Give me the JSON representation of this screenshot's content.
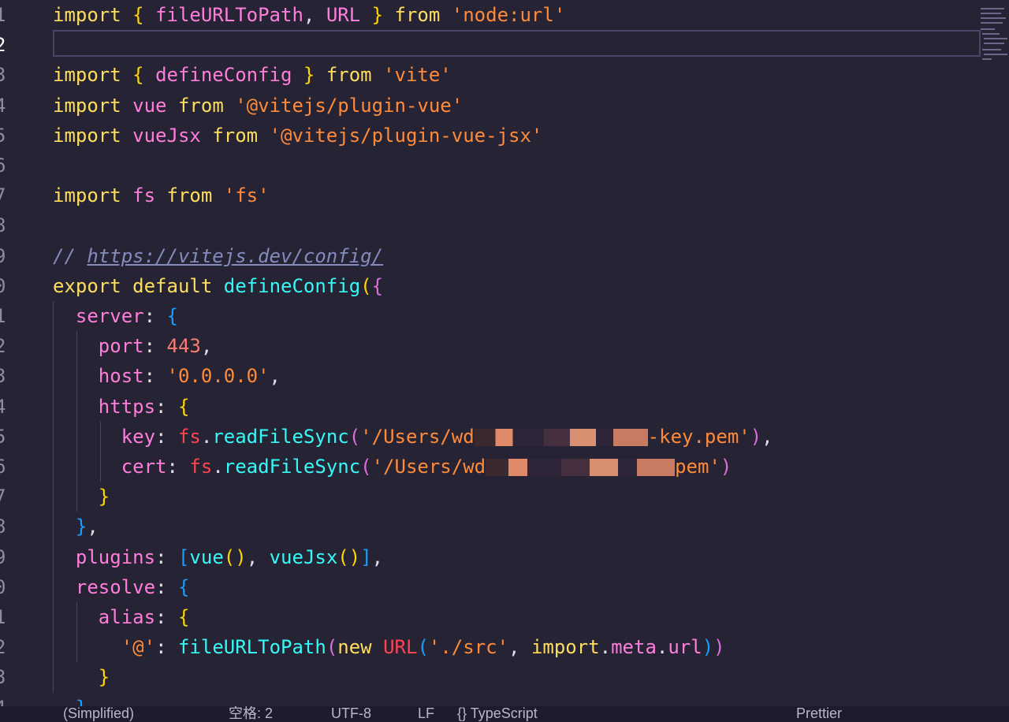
{
  "editor": {
    "active_line": 2,
    "lines": [
      {
        "n": "1",
        "tokens": [
          [
            "kw",
            "import"
          ],
          [
            "plain",
            " "
          ],
          [
            "br1",
            "{"
          ],
          [
            "plain",
            " "
          ],
          [
            "prop",
            "fileURLToPath"
          ],
          [
            "plain",
            ", "
          ],
          [
            "prop",
            "URL"
          ],
          [
            "plain",
            " "
          ],
          [
            "br1",
            "}"
          ],
          [
            "plain",
            " "
          ],
          [
            "kw",
            "from"
          ],
          [
            "plain",
            " "
          ],
          [
            "str",
            "'node:url'"
          ]
        ]
      },
      {
        "n": "2",
        "tokens": []
      },
      {
        "n": "3",
        "tokens": [
          [
            "kw",
            "import"
          ],
          [
            "plain",
            " "
          ],
          [
            "br1",
            "{"
          ],
          [
            "plain",
            " "
          ],
          [
            "prop",
            "defineConfig"
          ],
          [
            "plain",
            " "
          ],
          [
            "br1",
            "}"
          ],
          [
            "plain",
            " "
          ],
          [
            "kw",
            "from"
          ],
          [
            "plain",
            " "
          ],
          [
            "str",
            "'vite'"
          ]
        ]
      },
      {
        "n": "4",
        "tokens": [
          [
            "kw",
            "import"
          ],
          [
            "plain",
            " "
          ],
          [
            "prop",
            "vue"
          ],
          [
            "plain",
            " "
          ],
          [
            "kw",
            "from"
          ],
          [
            "plain",
            " "
          ],
          [
            "str",
            "'@vitejs/plugin-vue'"
          ]
        ]
      },
      {
        "n": "5",
        "tokens": [
          [
            "kw",
            "import"
          ],
          [
            "plain",
            " "
          ],
          [
            "prop",
            "vueJsx"
          ],
          [
            "plain",
            " "
          ],
          [
            "kw",
            "from"
          ],
          [
            "plain",
            " "
          ],
          [
            "str",
            "'@vitejs/plugin-vue-jsx'"
          ]
        ]
      },
      {
        "n": "6",
        "tokens": []
      },
      {
        "n": "7",
        "tokens": [
          [
            "kw",
            "import"
          ],
          [
            "plain",
            " "
          ],
          [
            "prop",
            "fs"
          ],
          [
            "plain",
            " "
          ],
          [
            "kw",
            "from"
          ],
          [
            "plain",
            " "
          ],
          [
            "str",
            "'fs'"
          ]
        ]
      },
      {
        "n": "8",
        "tokens": []
      },
      {
        "n": "9",
        "tokens": [
          [
            "cmt",
            "// "
          ],
          [
            "url",
            "https://vitejs.dev/config/"
          ]
        ]
      },
      {
        "n": "0",
        "tokens": [
          [
            "kw",
            "export"
          ],
          [
            "plain",
            " "
          ],
          [
            "kw",
            "default"
          ],
          [
            "plain",
            " "
          ],
          [
            "fn",
            "defineConfig"
          ],
          [
            "br1",
            "("
          ],
          [
            "br2",
            "{"
          ]
        ]
      },
      {
        "n": "1",
        "tokens": [
          [
            "plain",
            "  "
          ],
          [
            "prop",
            "server"
          ],
          [
            "plain",
            ": "
          ],
          [
            "br3",
            "{"
          ]
        ]
      },
      {
        "n": "2",
        "tokens": [
          [
            "plain",
            "    "
          ],
          [
            "prop",
            "port"
          ],
          [
            "plain",
            ": "
          ],
          [
            "num",
            "443"
          ],
          [
            "plain",
            ","
          ]
        ]
      },
      {
        "n": "3",
        "tokens": [
          [
            "plain",
            "    "
          ],
          [
            "prop",
            "host"
          ],
          [
            "plain",
            ": "
          ],
          [
            "str",
            "'0.0.0.0'"
          ],
          [
            "plain",
            ","
          ]
        ]
      },
      {
        "n": "4",
        "tokens": [
          [
            "plain",
            "    "
          ],
          [
            "prop",
            "https"
          ],
          [
            "plain",
            ": "
          ],
          [
            "br1",
            "{"
          ]
        ]
      },
      {
        "n": "5",
        "tokens": [
          [
            "plain",
            "      "
          ],
          [
            "prop",
            "key"
          ],
          [
            "plain",
            ": "
          ],
          [
            "mod",
            "fs"
          ],
          [
            "plain",
            "."
          ],
          [
            "fn",
            "readFileSync"
          ],
          [
            "br2",
            "("
          ],
          [
            "str",
            "'/Users/wd"
          ],
          [
            "blur",
            "220"
          ],
          [
            "str",
            "-key.pem'"
          ],
          [
            "br2",
            ")"
          ],
          [
            "plain",
            ","
          ]
        ]
      },
      {
        "n": "6",
        "tokens": [
          [
            "plain",
            "      "
          ],
          [
            "prop",
            "cert"
          ],
          [
            "plain",
            ": "
          ],
          [
            "mod",
            "fs"
          ],
          [
            "plain",
            "."
          ],
          [
            "fn",
            "readFileSync"
          ],
          [
            "br2",
            "("
          ],
          [
            "str",
            "'/Users/wd"
          ],
          [
            "blur",
            "240"
          ],
          [
            "str",
            "pem'"
          ],
          [
            "br2",
            ")"
          ]
        ]
      },
      {
        "n": "7",
        "tokens": [
          [
            "plain",
            "    "
          ],
          [
            "br1",
            "}"
          ]
        ]
      },
      {
        "n": "8",
        "tokens": [
          [
            "plain",
            "  "
          ],
          [
            "br3",
            "}"
          ],
          [
            "plain",
            ","
          ]
        ]
      },
      {
        "n": "9",
        "tokens": [
          [
            "plain",
            "  "
          ],
          [
            "prop",
            "plugins"
          ],
          [
            "plain",
            ": "
          ],
          [
            "br3",
            "["
          ],
          [
            "fn",
            "vue"
          ],
          [
            "br1",
            "()"
          ],
          [
            "plain",
            ", "
          ],
          [
            "fn",
            "vueJsx"
          ],
          [
            "br1",
            "()"
          ],
          [
            "br3",
            "]"
          ],
          [
            "plain",
            ","
          ]
        ]
      },
      {
        "n": "0",
        "tokens": [
          [
            "plain",
            "  "
          ],
          [
            "prop",
            "resolve"
          ],
          [
            "plain",
            ": "
          ],
          [
            "br3",
            "{"
          ]
        ]
      },
      {
        "n": "1",
        "tokens": [
          [
            "plain",
            "    "
          ],
          [
            "prop",
            "alias"
          ],
          [
            "plain",
            ": "
          ],
          [
            "br1",
            "{"
          ]
        ]
      },
      {
        "n": "2",
        "tokens": [
          [
            "plain",
            "      "
          ],
          [
            "str",
            "'@'"
          ],
          [
            "plain",
            ": "
          ],
          [
            "fn",
            "fileURLToPath"
          ],
          [
            "br2",
            "("
          ],
          [
            "kw",
            "new"
          ],
          [
            "plain",
            " "
          ],
          [
            "mod",
            "URL"
          ],
          [
            "br3",
            "("
          ],
          [
            "str",
            "'./src'"
          ],
          [
            "plain",
            ", "
          ],
          [
            "kw",
            "import"
          ],
          [
            "plain",
            "."
          ],
          [
            "prop",
            "meta"
          ],
          [
            "plain",
            "."
          ],
          [
            "prop",
            "url"
          ],
          [
            "br3",
            ")"
          ],
          [
            "br2",
            ")"
          ]
        ]
      },
      {
        "n": "3",
        "tokens": [
          [
            "plain",
            "    "
          ],
          [
            "br1",
            "}"
          ]
        ]
      },
      {
        "n": "4",
        "tokens": [
          [
            "plain",
            "  "
          ],
          [
            "br3",
            "}"
          ]
        ]
      }
    ]
  },
  "statusbar": {
    "items": [
      "(Simplified)",
      "空格: 2",
      "UTF-8",
      "LF",
      "{} TypeScript",
      "Prettier"
    ]
  }
}
